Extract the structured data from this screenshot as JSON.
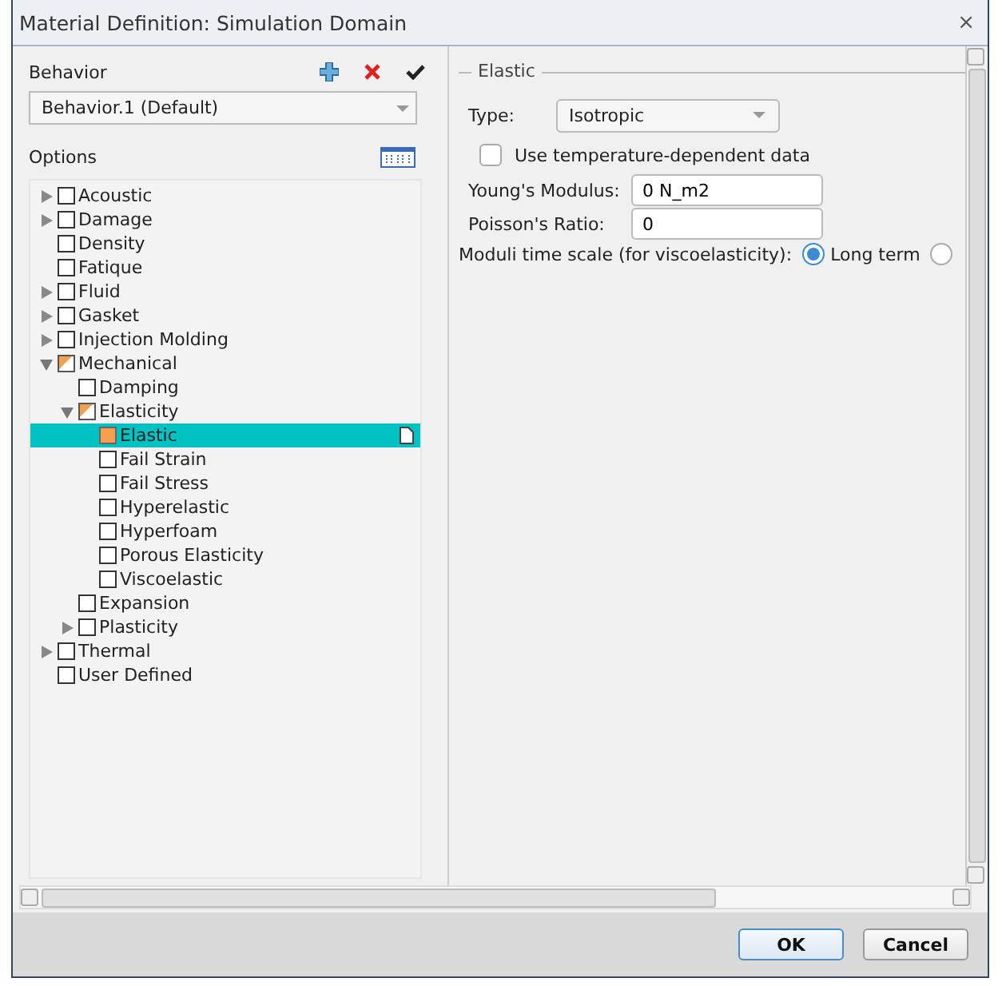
{
  "window": {
    "title": "Material Definition: Simulation Domain",
    "close": "×"
  },
  "behavior": {
    "label": "Behavior",
    "value": "Behavior.1 (Default)"
  },
  "options": {
    "label": "Options"
  },
  "tree": [
    {
      "label": "Acoustic",
      "checked": false,
      "partial": false,
      "expanded": false,
      "selected": false
    },
    {
      "label": "Damage",
      "checked": false,
      "partial": false,
      "expanded": false,
      "selected": false
    },
    {
      "label": "Density",
      "checked": false,
      "partial": false,
      "selected": false
    },
    {
      "label": "Fatique",
      "checked": false,
      "partial": false,
      "selected": false
    },
    {
      "label": "Fluid",
      "checked": false,
      "partial": false,
      "expanded": false,
      "selected": false
    },
    {
      "label": "Gasket",
      "checked": false,
      "partial": false,
      "expanded": false,
      "selected": false
    },
    {
      "label": "Injection Molding",
      "checked": false,
      "partial": false,
      "expanded": false,
      "selected": false
    },
    {
      "label": "Mechanical",
      "checked": true,
      "partial": true,
      "expanded": true,
      "selected": false,
      "children": [
        {
          "label": "Damping",
          "checked": false,
          "partial": false,
          "selected": false
        },
        {
          "label": "Elasticity",
          "checked": true,
          "partial": true,
          "expanded": true,
          "selected": false,
          "children": [
            {
              "label": "Elastic",
              "checked": true,
              "partial": false,
              "selected": true
            },
            {
              "label": "Fail Strain",
              "checked": false,
              "partial": false,
              "selected": false
            },
            {
              "label": "Fail Stress",
              "checked": false,
              "partial": false,
              "selected": false
            },
            {
              "label": "Hyperelastic",
              "checked": false,
              "partial": false,
              "selected": false
            },
            {
              "label": "Hyperfoam",
              "checked": false,
              "partial": false,
              "selected": false
            },
            {
              "label": "Porous Elasticity",
              "checked": false,
              "partial": false,
              "selected": false
            },
            {
              "label": "Viscoelastic",
              "checked": false,
              "partial": false,
              "selected": false
            }
          ]
        },
        {
          "label": "Expansion",
          "checked": false,
          "partial": false,
          "selected": false
        },
        {
          "label": "Plasticity",
          "checked": false,
          "partial": false,
          "expanded": false,
          "selected": false
        }
      ]
    },
    {
      "label": "Thermal",
      "checked": false,
      "partial": false,
      "expanded": false,
      "selected": false
    },
    {
      "label": "User Defined",
      "checked": false,
      "partial": false,
      "selected": false
    }
  ],
  "elastic": {
    "title": "Elastic",
    "type_label": "Type:",
    "type_value": "Isotropic",
    "temperature": {
      "label": "Use temperature-dependent data",
      "checked": false
    },
    "fields": [
      {
        "label": "Young's Modulus:",
        "value": "0 N_m2"
      },
      {
        "label": "Poisson's Ratio:",
        "value": "0"
      }
    ],
    "moduli_label": "Moduli time scale (for viscoelasticity):",
    "moduli_options": [
      {
        "label": "Long term",
        "selected": true
      },
      {
        "selected": false
      }
    ]
  },
  "buttons": [
    {
      "label": "OK",
      "kind": "default"
    },
    {
      "label": "Cancel",
      "kind": "normal"
    }
  ]
}
